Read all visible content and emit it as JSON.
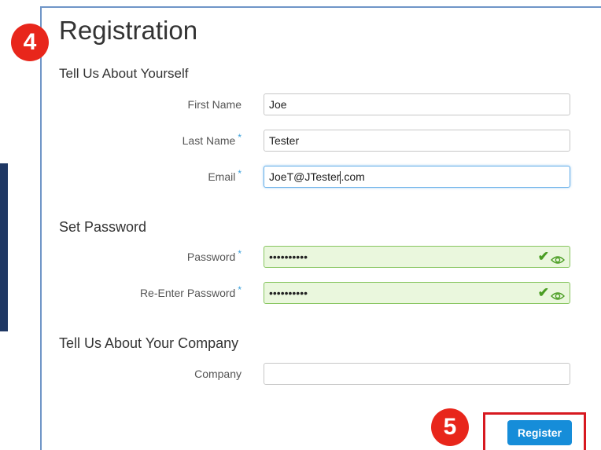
{
  "step_badges": {
    "registration": "4",
    "register": "5"
  },
  "page_title": "Registration",
  "sections": {
    "about": "Tell Us About Yourself",
    "password": "Set Password",
    "company": "Tell Us About Your Company"
  },
  "fields": {
    "first_name": {
      "label": "First Name",
      "value": "Joe",
      "required": false
    },
    "last_name": {
      "label": "Last Name",
      "value": "Tester",
      "required": true
    },
    "email": {
      "label": "Email",
      "value_before_cursor": "JoeT@JTester",
      "value_after_cursor": ".com",
      "required": true,
      "state": "focused"
    },
    "password": {
      "label": "Password",
      "value": "••••••••••",
      "required": true,
      "state": "valid"
    },
    "re_password": {
      "label": "Re-Enter Password",
      "value": "••••••••••",
      "required": true,
      "state": "valid"
    },
    "company": {
      "label": "Company",
      "value": "",
      "required": false
    }
  },
  "required_marker": "*",
  "icons": {
    "valid": "check-icon",
    "reveal": "eye-icon"
  },
  "register_label": "Register",
  "colors": {
    "accent": "#168dd9",
    "badge": "#e8261b",
    "highlight_frame": "#d71920",
    "valid_bg": "#eaf7dd",
    "valid_check": "#4a9d23"
  }
}
